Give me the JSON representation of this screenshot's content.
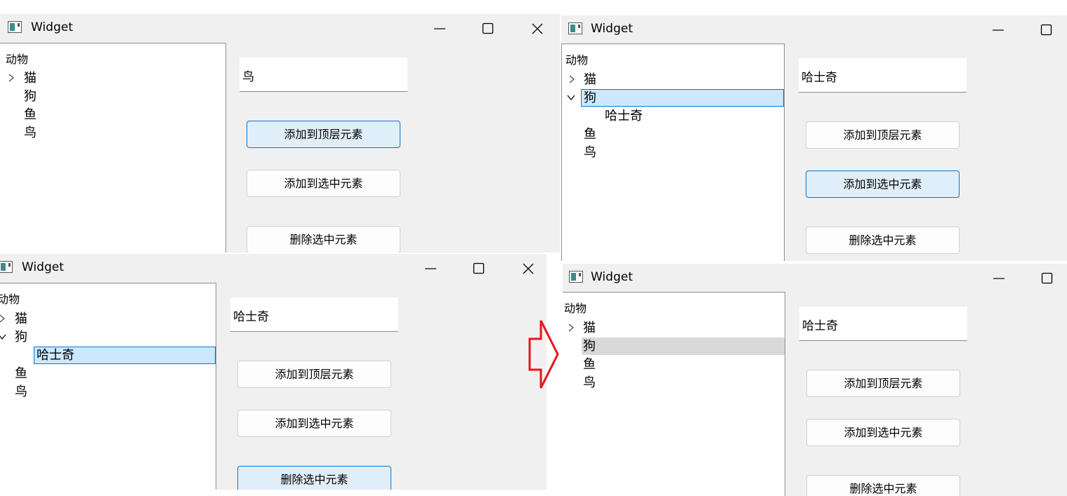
{
  "app": {
    "title": "Widget"
  },
  "tree": {
    "header": "动物",
    "items": {
      "cat": "猫",
      "dog": "狗",
      "fish": "鱼",
      "bird": "鸟"
    },
    "child": "哈士奇"
  },
  "panels": {
    "p1": {
      "input_value": "鸟"
    },
    "p2": {
      "input_value": "哈士奇"
    },
    "p3": {
      "input_value": "哈士奇"
    },
    "p4": {
      "input_value": "哈士奇"
    }
  },
  "buttons": {
    "add_top": "添加到顶层元素",
    "add_selected": "添加到选中元素",
    "delete_selected": "删除选中元素"
  },
  "icons": {
    "app": "qt-widget-icon",
    "minimize": "minimize-icon",
    "maximize": "maximize-icon",
    "close": "close-icon",
    "collapsed": "chevron-right-icon",
    "expanded": "chevron-down-icon",
    "transition": "right-arrow-icon"
  },
  "colors": {
    "selection": "#cce8ff",
    "selection_border": "#0078d7",
    "button_hover": "#e0eef9",
    "inactive_selection": "#d9d9d9",
    "arrow": "#e8131b"
  }
}
